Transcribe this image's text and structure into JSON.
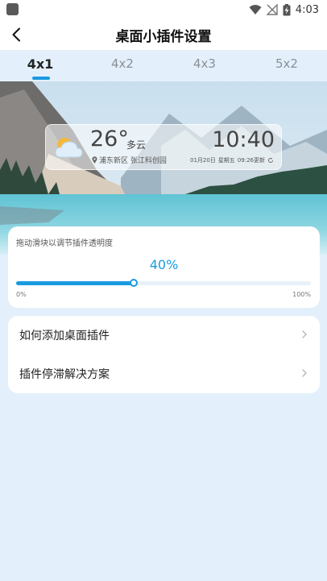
{
  "status_bar": {
    "time": "4:03",
    "icons": [
      "app-notification-icon",
      "wifi-icon",
      "signal-off-icon",
      "battery-charging-icon"
    ]
  },
  "app_bar": {
    "title": "桌面小插件设置",
    "back_icon": "back-arrow-icon"
  },
  "tabs": [
    {
      "label": "4x1",
      "active": true
    },
    {
      "label": "4x2",
      "active": false
    },
    {
      "label": "4x3",
      "active": false
    },
    {
      "label": "5x2",
      "active": false
    }
  ],
  "widget_preview": {
    "temperature": "26°",
    "condition": "多云",
    "location": "浦东新区 张江科创园",
    "time": "10:40",
    "date": "01月20日",
    "weekday": "星期五",
    "updated": "09:26更新",
    "weather_icon": "cloudy-sun-icon"
  },
  "opacity": {
    "caption": "拖动滑块以调节插件透明度",
    "value_label": "40%",
    "value": 0.4,
    "min_label": "0%",
    "max_label": "100%",
    "accent": "#1a9be0"
  },
  "menu": [
    {
      "label": "如何添加桌面插件"
    },
    {
      "label": "插件停滞解决方案"
    }
  ]
}
